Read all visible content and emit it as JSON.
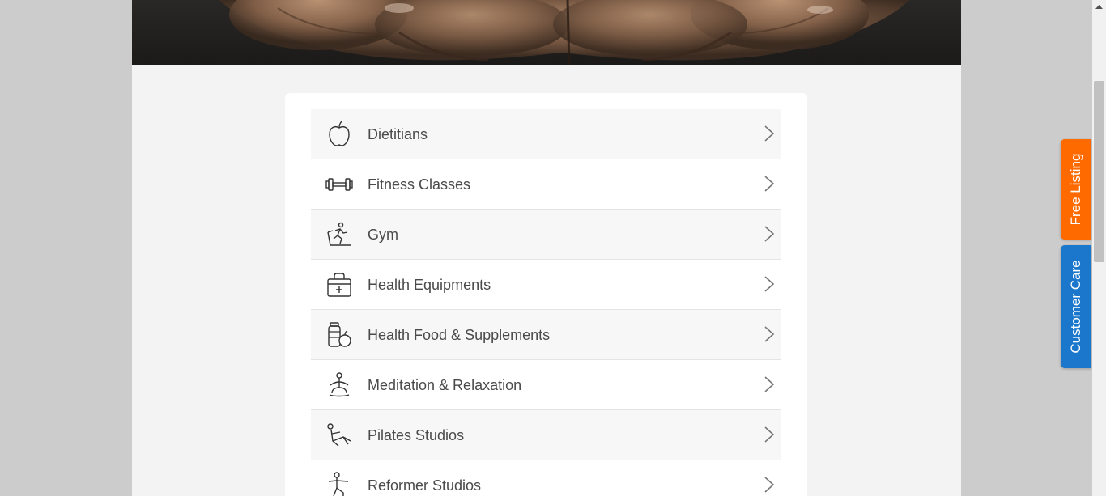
{
  "categories": [
    {
      "label": "Dietitians",
      "icon": "apple-icon"
    },
    {
      "label": "Fitness Classes",
      "icon": "dumbbell-icon"
    },
    {
      "label": "Gym",
      "icon": "treadmill-runner-icon"
    },
    {
      "label": "Health Equipments",
      "icon": "medical-bag-icon"
    },
    {
      "label": "Health Food & Supplements",
      "icon": "supplements-icon"
    },
    {
      "label": "Meditation & Relaxation",
      "icon": "meditation-icon"
    },
    {
      "label": "Pilates Studios",
      "icon": "pilates-icon"
    },
    {
      "label": "Reformer Studios",
      "icon": "reformer-icon"
    }
  ],
  "side_tabs": {
    "free_listing": "Free Listing",
    "customer_care": "Customer Care"
  },
  "colors": {
    "free_listing": "#ff6a00",
    "customer_care": "#1a77cc",
    "label_text": "#4a4a4a"
  }
}
